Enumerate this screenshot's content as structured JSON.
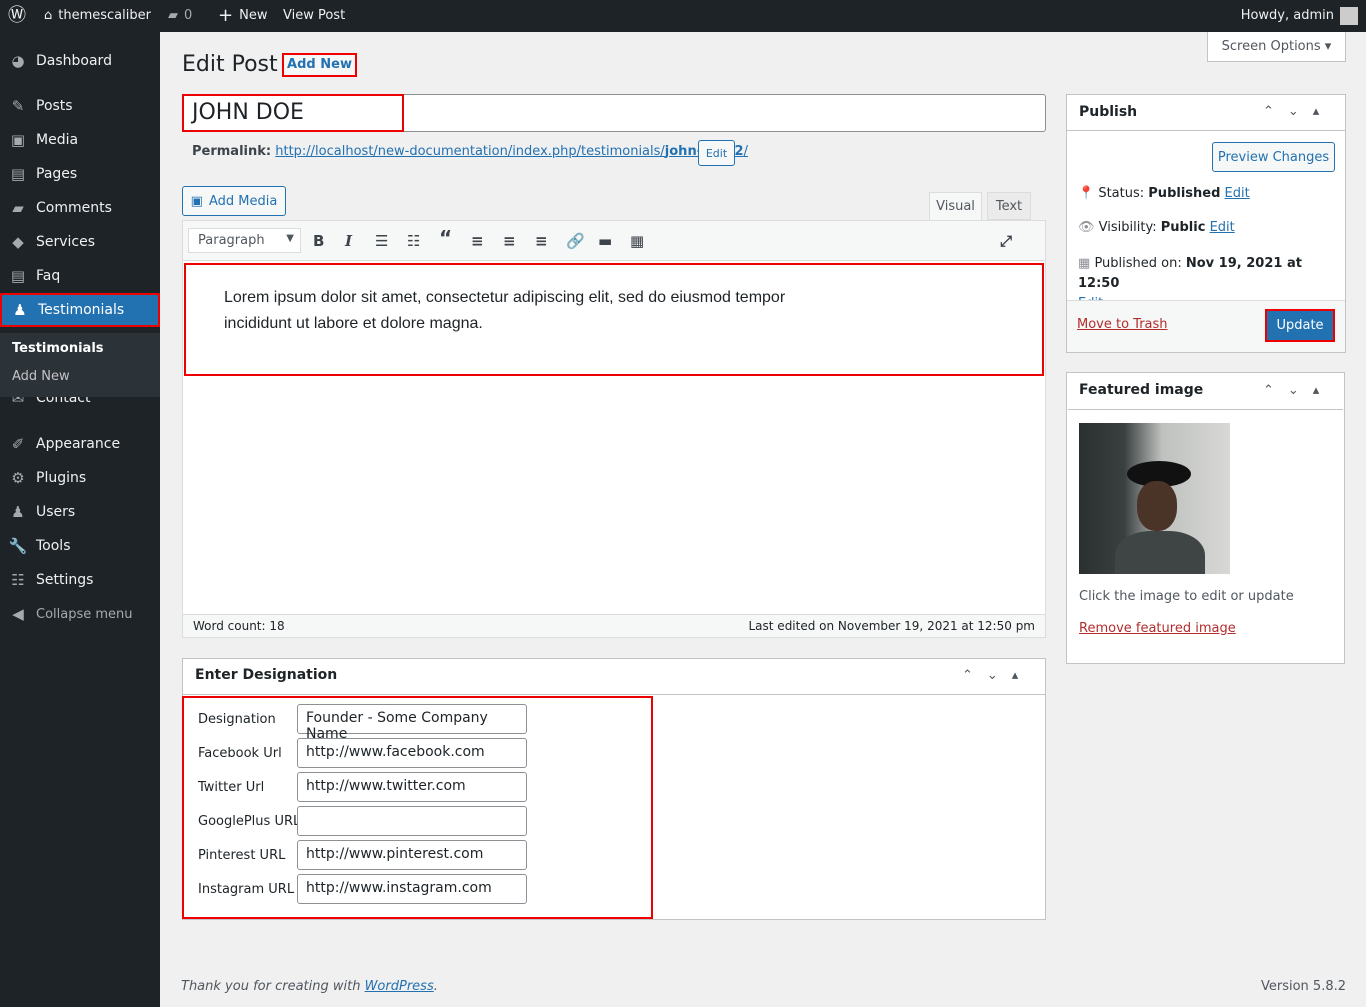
{
  "adminbar": {
    "site": "themescaliber",
    "comments": "0",
    "new": "New",
    "view": "View Post",
    "howdy": "Howdy, admin"
  },
  "sidebar": {
    "items": [
      {
        "label": "Dashboard",
        "icon": "dashboard-icon"
      },
      {
        "label": "Posts",
        "icon": "pin-icon"
      },
      {
        "label": "Media",
        "icon": "media-icon"
      },
      {
        "label": "Pages",
        "icon": "pages-icon"
      },
      {
        "label": "Comments",
        "icon": "comment-icon"
      },
      {
        "label": "Services",
        "icon": "tag-icon"
      },
      {
        "label": "Faq",
        "icon": "document-icon"
      },
      {
        "label": "Testimonials",
        "icon": "user-icon"
      },
      {
        "label": "Contact",
        "icon": "mail-icon"
      },
      {
        "label": "Appearance",
        "icon": "brush-icon"
      },
      {
        "label": "Plugins",
        "icon": "plugin-icon"
      },
      {
        "label": "Users",
        "icon": "users-icon"
      },
      {
        "label": "Tools",
        "icon": "wrench-icon"
      },
      {
        "label": "Settings",
        "icon": "settings-icon"
      },
      {
        "label": "Collapse menu",
        "icon": "collapse-icon"
      }
    ],
    "submenu": [
      "Testimonials",
      "Add New"
    ]
  },
  "header": {
    "title": "Edit Post",
    "add_new": "Add New",
    "screen_options": "Screen Options"
  },
  "post": {
    "title": "JOHN DOE",
    "permalink_label": "Permalink:",
    "permalink_base": "http://localhost/new-documentation/index.php/testimonials/",
    "permalink_slug": "john-doe-2",
    "permalink_end": "/",
    "edit": "Edit"
  },
  "editor": {
    "add_media": "Add Media",
    "tab_visual": "Visual",
    "tab_text": "Text",
    "format": "Paragraph",
    "content": "Lorem ipsum dolor sit amet, consectetur adipiscing elit, sed do eiusmod tempor incididunt ut labore et dolore magna.",
    "word_count": "Word count: 18",
    "last_edited": "Last edited on November 19, 2021 at 12:50 pm"
  },
  "designation": {
    "title": "Enter Designation",
    "fields": [
      {
        "label": "Designation",
        "value": "Founder - Some Company Name"
      },
      {
        "label": "Facebook Url",
        "value": "http://www.facebook.com"
      },
      {
        "label": "Twitter Url",
        "value": "http://www.twitter.com"
      },
      {
        "label": "GooglePlus URL",
        "value": ""
      },
      {
        "label": "Pinterest URL",
        "value": "http://www.pinterest.com"
      },
      {
        "label": "Instagram URL",
        "value": "http://www.instagram.com"
      }
    ]
  },
  "publish": {
    "title": "Publish",
    "preview": "Preview Changes",
    "status_label": "Status:",
    "status": "Published",
    "visibility_label": "Visibility:",
    "visibility": "Public",
    "published_label": "Published on:",
    "published": "Nov 19, 2021 at 12:50",
    "edit": "Edit",
    "trash": "Move to Trash",
    "update": "Update"
  },
  "featured": {
    "title": "Featured image",
    "hint": "Click the image to edit or update",
    "remove": "Remove featured image"
  },
  "footer": {
    "thanks": "Thank you for creating with ",
    "wp": "WordPress",
    "dot": ".",
    "version": "Version 5.8.2"
  }
}
